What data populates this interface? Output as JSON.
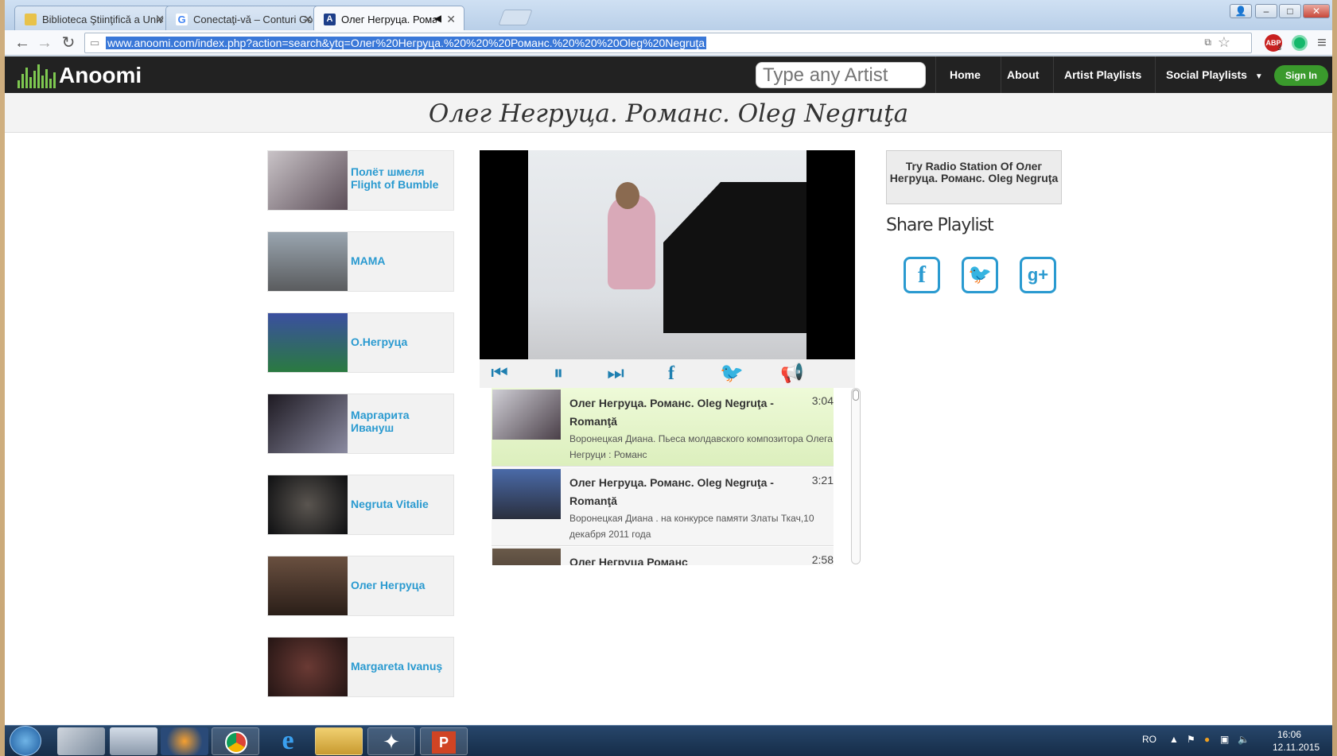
{
  "browser": {
    "tabs": [
      {
        "label": "Biblioteca Ştiinţifică a Univ",
        "favicon_color": "#e8c24a"
      },
      {
        "label": "Conectaţi-vă – Conturi Go",
        "favicon_color": "#4285f4"
      },
      {
        "label": "Олег Негруца. Романс",
        "favicon_color": "#1e3f8a",
        "favicon_letter": "A",
        "muted_icon": "speaker-icon"
      }
    ],
    "url": "www.anoomi.com/index.php?action=search&ytq=Олег%20Негруца.%20%20%20Романс.%20%20%20Oleg%20Negruţa",
    "window_buttons": [
      "user-icon",
      "minimize-icon",
      "maximize-icon",
      "close-icon"
    ],
    "extension_icons": [
      "translate-icon",
      "star-icon",
      "adblock-icon",
      "grammarly-icon",
      "menu-icon"
    ],
    "adblock_count": "3"
  },
  "site": {
    "logo_text": "Anoomi",
    "search_placeholder": "Type any Artist",
    "nav": {
      "home": "Home",
      "about": "About",
      "artist_playlists": "Artist Playlists",
      "social_playlists": "Social Playlists",
      "sign_in": "Sign In"
    },
    "brand_color": "#2a9ad0",
    "signin_color": "#3a9a2c"
  },
  "page_title": "Олег Негруца. Романс. Oleg Negruţa",
  "related_artists": [
    {
      "label": "Полёт шмеля Flight of Bumble",
      "thumb_color": "#7b6a74"
    },
    {
      "label": "МАМА",
      "thumb_color": "#6d6f72"
    },
    {
      "label": "О.Негруца",
      "thumb_color": "#3b4fa0"
    },
    {
      "label": "Маргарита Ивануш",
      "thumb_color": "#2d2a35"
    },
    {
      "label": "Negruta Vitalie",
      "thumb_color": "#1d1f22"
    },
    {
      "label": "Олег Негруца",
      "thumb_color": "#4a3a2e"
    },
    {
      "label": "Margareta Ivanuş",
      "thumb_color": "#3a2422"
    }
  ],
  "player": {
    "controls": [
      "previous-icon",
      "pause-icon",
      "next-icon",
      "facebook-icon",
      "twitter-icon",
      "megaphone-icon"
    ]
  },
  "playlist": [
    {
      "title": "Олег Негруца. Романс. Oleg Negruţa - Romanţă",
      "duration": "3:04",
      "description": "Воронецкая Диана. Пьеса молдавского композитора Олега Негруци : Романс",
      "current": true
    },
    {
      "title": "Олег Негруца. Романс. Oleg Negruţa - Romanţă",
      "duration": "3:21",
      "description": "Воронецкая Диана . на конкурсе памяти Златы Ткач,10 декабря 2011 года",
      "current": false
    },
    {
      "title": "Олег Негруца Романс",
      "duration": "2:58",
      "description": "",
      "current": false
    }
  ],
  "sidebar": {
    "radio_label": "Try Radio Station Of Олег Негруца. Романс. Oleg Negruţa",
    "share_title": "Share Playlist",
    "share_buttons": [
      "facebook-icon",
      "twitter-icon",
      "google-plus-icon"
    ]
  },
  "taskbar": {
    "apps": [
      "marc-icon",
      "calculator-icon",
      "media-player-icon",
      "chrome-icon",
      "ie-icon",
      "explorer-icon",
      "tool-icon",
      "powerpoint-icon"
    ],
    "language": "RO",
    "time": "16:06",
    "date": "12.11.2015"
  }
}
